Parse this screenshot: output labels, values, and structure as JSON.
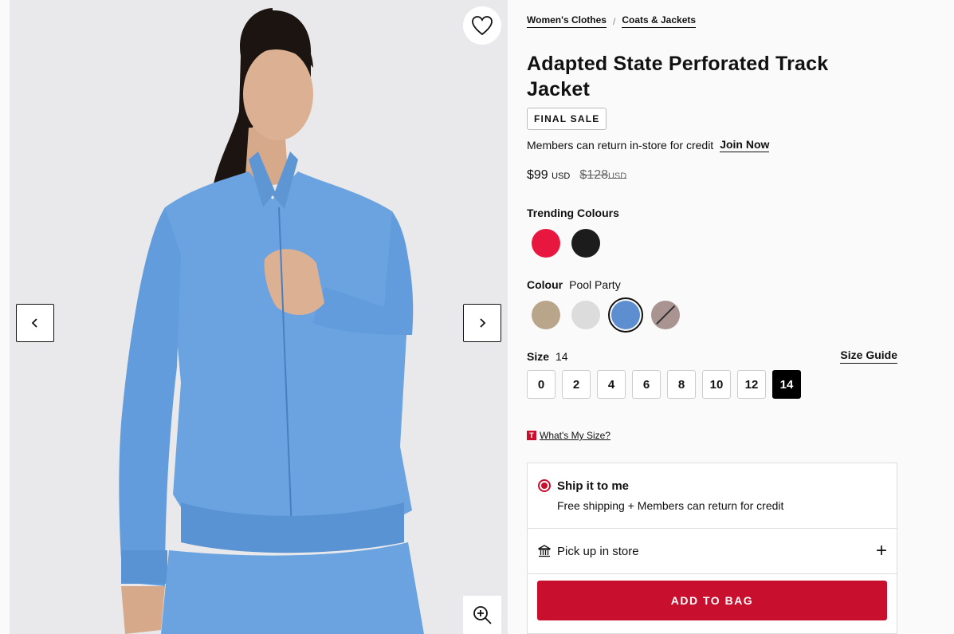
{
  "breadcrumb": [
    "Women's Clothes",
    "Coats & Jackets"
  ],
  "product": {
    "title": "Adapted State Perforated Track Jacket",
    "badge": "FINAL SALE",
    "member_text": "Members can return in-store for credit",
    "join_label": "Join Now",
    "price": "$99",
    "price_currency": "USD",
    "old_price": "$128",
    "old_currency": "USD"
  },
  "trending": {
    "label": "Trending Colours",
    "colors": [
      "#e8173f",
      "#1c1c1c"
    ]
  },
  "colour": {
    "label": "Colour",
    "selected": "Pool Party",
    "swatches": [
      {
        "color": "#b9a58a",
        "selected": false,
        "unavailable": false
      },
      {
        "color": "#dcdcdc",
        "selected": false,
        "unavailable": false
      },
      {
        "color": "#5d8fd0",
        "selected": true,
        "unavailable": false
      },
      {
        "color": "#a99491",
        "selected": false,
        "unavailable": true
      }
    ]
  },
  "size": {
    "label": "Size",
    "selected": "14",
    "guide_label": "Size Guide",
    "options": [
      "0",
      "2",
      "4",
      "6",
      "8",
      "10",
      "12",
      "14"
    ]
  },
  "whats_my_size": {
    "icon_letter": "T",
    "label": "What's My Size?"
  },
  "fulfillment": {
    "ship_title": "Ship it to me",
    "ship_sub": "Free shipping + Members can return for credit",
    "pickup_label": "Pick up in store",
    "add_to_bag": "ADD TO BAG"
  },
  "colors": {
    "accent": "#c8102e",
    "jacket": "#6aa3e0"
  }
}
